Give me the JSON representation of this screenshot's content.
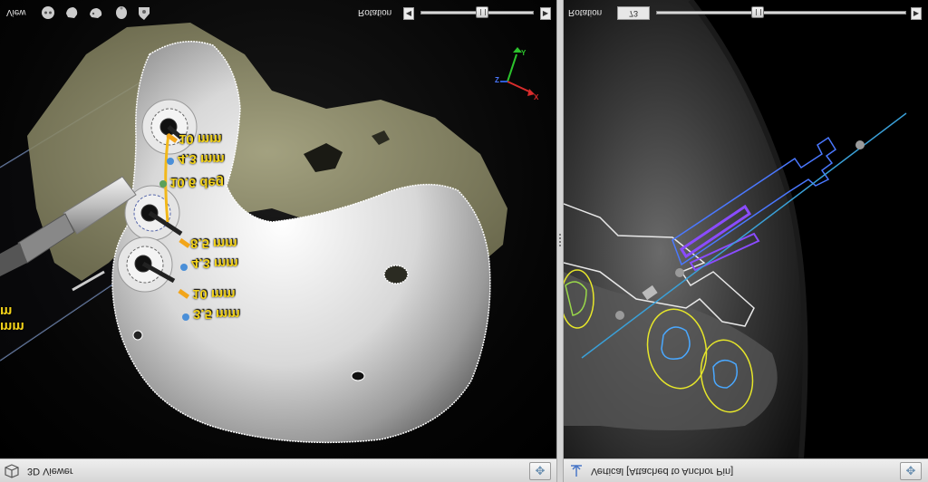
{
  "left_viewer": {
    "view_label": "View",
    "rotation_label": "Rotation",
    "rotation_slider_value": 0.55,
    "panel_title": "3D Viewer",
    "view_icons": [
      "head-front-icon",
      "head-side-icon",
      "head-oblique-icon",
      "skull-icon",
      "skull-shield-icon"
    ],
    "axis": {
      "y": "Y",
      "x": "X",
      "z": "Z"
    },
    "measurements": [
      "10 mm",
      "4.3 mm",
      "10.6 deg",
      "8.5 mm",
      "4.3 mm",
      "10 mm",
      "3.5 mm"
    ],
    "cut_off_labels": [
      "m",
      "mm"
    ]
  },
  "right_viewer": {
    "rotation_label": "Rotation",
    "slice_value": "73",
    "slice_slider_value": 0.4,
    "panel_title": "Vertical [Attached to Anchor Pin]"
  },
  "colors": {
    "measurement": "#f2d21a",
    "implant_outline": "#4a78ff",
    "trajectory": "#3aa0d8",
    "nerve_outline": "#e6e62a",
    "nerve_inner": "#4aa8ff",
    "accent_purple": "#8a4cff"
  }
}
